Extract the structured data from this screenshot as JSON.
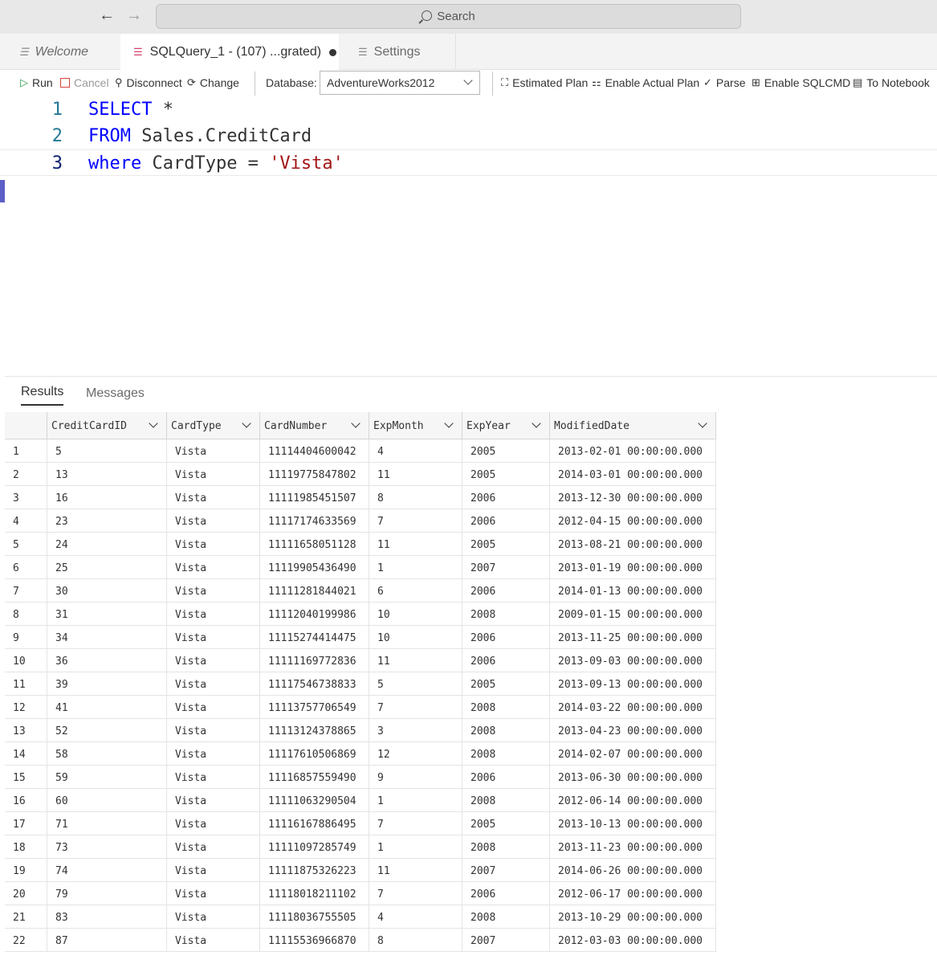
{
  "titlebar": {
    "back_glyph": "←",
    "forward_glyph": "→",
    "search_placeholder": "Search"
  },
  "tabs": [
    {
      "label": "Welcome",
      "icon": "lines-icon"
    },
    {
      "label": "SQLQuery_1 - (107) ...grated)",
      "icon": "database-icon",
      "unsaved": true
    },
    {
      "label": "Settings",
      "icon": "lines-icon"
    }
  ],
  "toolbar": {
    "run": "Run",
    "cancel": "Cancel",
    "disconnect": "Disconnect",
    "change": "Change",
    "database_label": "Database:",
    "database_value": "AdventureWorks2012",
    "estimated_plan": "Estimated Plan",
    "enable_actual_plan": "Enable Actual Plan",
    "parse": "Parse",
    "enable_sqlcmd": "Enable SQLCMD",
    "to_notebook": "To Notebook"
  },
  "editor": {
    "lines": [
      {
        "num": "1",
        "tokens": [
          {
            "t": "SELECT",
            "k": "kw"
          },
          {
            "t": " *",
            "k": ""
          }
        ]
      },
      {
        "num": "2",
        "tokens": [
          {
            "t": "FROM",
            "k": "kw"
          },
          {
            "t": " Sales.CreditCard",
            "k": ""
          }
        ]
      },
      {
        "num": "3",
        "tokens": [
          {
            "t": "where",
            "k": "kw"
          },
          {
            "t": " CardType = ",
            "k": ""
          },
          {
            "t": "'Vista'",
            "k": "str"
          }
        ]
      }
    ]
  },
  "results": {
    "tab_results": "Results",
    "tab_messages": "Messages",
    "columns": [
      "CreditCardID",
      "CardType",
      "CardNumber",
      "ExpMonth",
      "ExpYear",
      "ModifiedDate"
    ],
    "rows": [
      [
        "1",
        "5",
        "Vista",
        "11114404600042",
        "4",
        "2005",
        "2013-02-01 00:00:00.000"
      ],
      [
        "2",
        "13",
        "Vista",
        "11119775847802",
        "11",
        "2005",
        "2014-03-01 00:00:00.000"
      ],
      [
        "3",
        "16",
        "Vista",
        "11111985451507",
        "8",
        "2006",
        "2013-12-30 00:00:00.000"
      ],
      [
        "4",
        "23",
        "Vista",
        "11117174633569",
        "7",
        "2006",
        "2012-04-15 00:00:00.000"
      ],
      [
        "5",
        "24",
        "Vista",
        "11111658051128",
        "11",
        "2005",
        "2013-08-21 00:00:00.000"
      ],
      [
        "6",
        "25",
        "Vista",
        "11119905436490",
        "1",
        "2007",
        "2013-01-19 00:00:00.000"
      ],
      [
        "7",
        "30",
        "Vista",
        "11111281844021",
        "6",
        "2006",
        "2014-01-13 00:00:00.000"
      ],
      [
        "8",
        "31",
        "Vista",
        "11112040199986",
        "10",
        "2008",
        "2009-01-15 00:00:00.000"
      ],
      [
        "9",
        "34",
        "Vista",
        "11115274414475",
        "10",
        "2006",
        "2013-11-25 00:00:00.000"
      ],
      [
        "10",
        "36",
        "Vista",
        "11111169772836",
        "11",
        "2006",
        "2013-09-03 00:00:00.000"
      ],
      [
        "11",
        "39",
        "Vista",
        "11117546738833",
        "5",
        "2005",
        "2013-09-13 00:00:00.000"
      ],
      [
        "12",
        "41",
        "Vista",
        "11113757706549",
        "7",
        "2008",
        "2014-03-22 00:00:00.000"
      ],
      [
        "13",
        "52",
        "Vista",
        "11113124378865",
        "3",
        "2008",
        "2013-04-23 00:00:00.000"
      ],
      [
        "14",
        "58",
        "Vista",
        "11117610506869",
        "12",
        "2008",
        "2014-02-07 00:00:00.000"
      ],
      [
        "15",
        "59",
        "Vista",
        "11116857559490",
        "9",
        "2006",
        "2013-06-30 00:00:00.000"
      ],
      [
        "16",
        "60",
        "Vista",
        "11111063290504",
        "1",
        "2008",
        "2012-06-14 00:00:00.000"
      ],
      [
        "17",
        "71",
        "Vista",
        "11116167886495",
        "7",
        "2005",
        "2013-10-13 00:00:00.000"
      ],
      [
        "18",
        "73",
        "Vista",
        "11111097285749",
        "1",
        "2008",
        "2013-11-23 00:00:00.000"
      ],
      [
        "19",
        "74",
        "Vista",
        "11111875326223",
        "11",
        "2007",
        "2014-06-26 00:00:00.000"
      ],
      [
        "20",
        "79",
        "Vista",
        "11118018211102",
        "7",
        "2006",
        "2012-06-17 00:00:00.000"
      ],
      [
        "21",
        "83",
        "Vista",
        "11118036755505",
        "4",
        "2008",
        "2013-10-29 00:00:00.000"
      ],
      [
        "22",
        "87",
        "Vista",
        "11115536966870",
        "8",
        "2007",
        "2012-03-03 00:00:00.000"
      ]
    ]
  }
}
